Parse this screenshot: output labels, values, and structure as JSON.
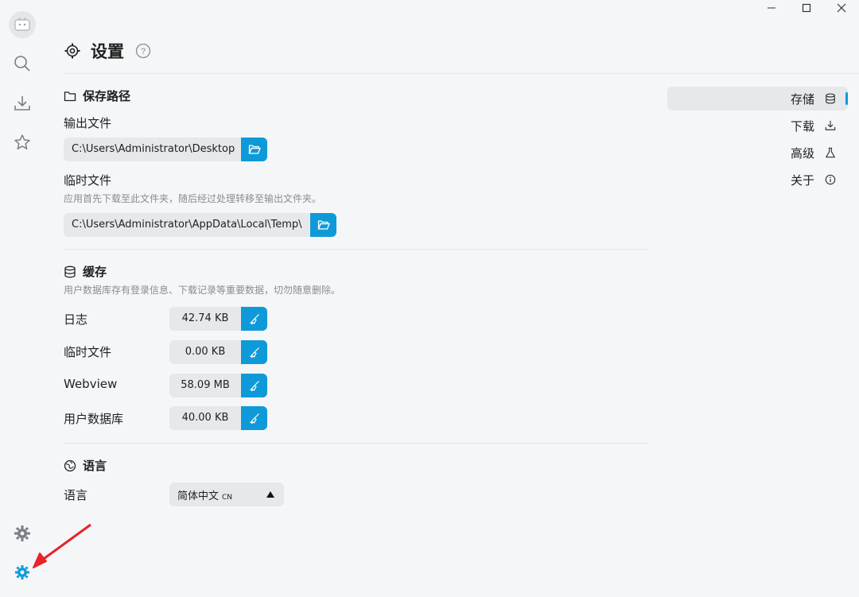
{
  "header": {
    "title": "设置"
  },
  "storage": {
    "section_title": "保存路径",
    "output_label": "输出文件",
    "output_path": "C:\\Users\\Administrator\\Desktop",
    "temp_label": "临时文件",
    "temp_hint": "应用首先下载至此文件夹，随后经过处理转移至输出文件夹。",
    "temp_path": "C:\\Users\\Administrator\\AppData\\Local\\Temp\\"
  },
  "cache": {
    "section_title": "缓存",
    "hint": "用户数据库存有登录信息、下载记录等重要数据，切勿随意删除。",
    "rows": [
      {
        "label": "日志",
        "size": "42.74 KB"
      },
      {
        "label": "临时文件",
        "size": "0.00 KB"
      },
      {
        "label": "Webview",
        "size": "58.09 MB"
      },
      {
        "label": "用户数据库",
        "size": "40.00 KB"
      }
    ]
  },
  "language": {
    "section_title": "语言",
    "label": "语言",
    "selected": "简体中文",
    "code": "CN"
  },
  "right_nav": [
    {
      "label": "存储",
      "icon": "database-icon",
      "active": true
    },
    {
      "label": "下载",
      "icon": "download-icon"
    },
    {
      "label": "高级",
      "icon": "flask-icon"
    },
    {
      "label": "关于",
      "icon": "info-icon"
    }
  ],
  "sidebar": {
    "items": [
      "avatar",
      "search-icon",
      "download-icon",
      "star-icon",
      "theme-gear-icon",
      "settings-icon"
    ]
  },
  "colors": {
    "accent": "#0e9ad8",
    "annotation": "#e8232a"
  }
}
